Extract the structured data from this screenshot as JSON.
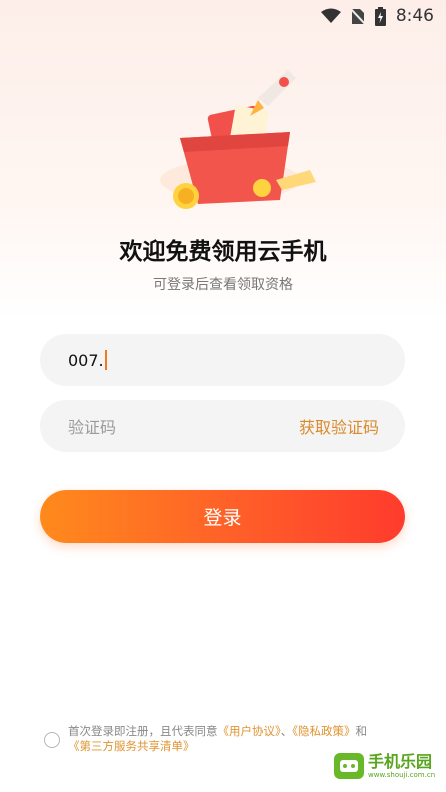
{
  "status_bar": {
    "time": "8:46",
    "icons": [
      "wifi-icon",
      "no-sim-icon",
      "battery-charging-icon"
    ]
  },
  "hero": {
    "image": "gift-box-rocket-illustration"
  },
  "header": {
    "title": "欢迎免费领用云手机",
    "subtitle": "可登录后查看领取资格"
  },
  "form": {
    "phone_value": "007.",
    "code_placeholder": "验证码",
    "get_code_label": "获取验证码",
    "login_label": "登录"
  },
  "agreement": {
    "prefix": "首次登录即注册，且代表同意",
    "user_agreement": "《用户协议》",
    "sep1": "、",
    "privacy_policy": "《隐私政策》",
    "and": "和",
    "third_party_list": "《第三方服务共享清单》"
  },
  "watermark": {
    "name": "手机乐园",
    "url": "www.shouji.com.cn"
  },
  "colors": {
    "accent": "#ff5a2a",
    "link": "#e0932f"
  }
}
